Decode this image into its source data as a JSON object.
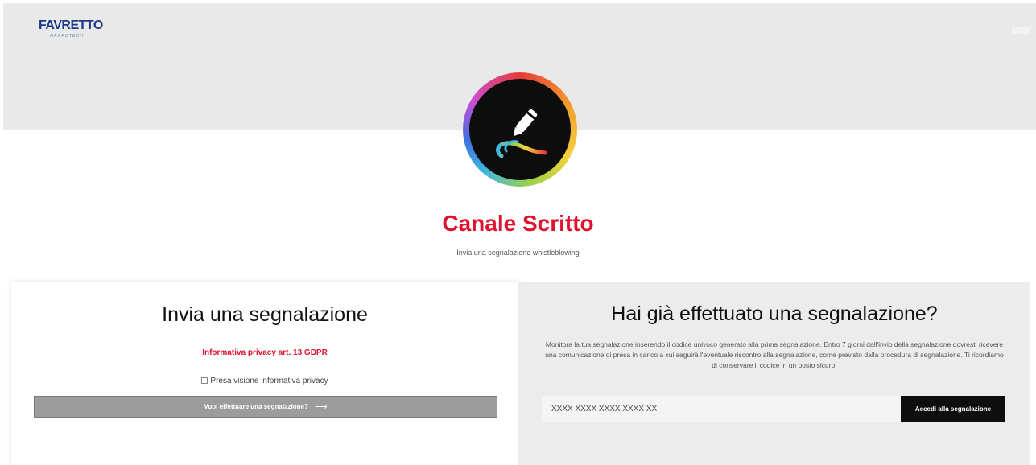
{
  "header": {
    "logo_main": "FAVRETTO",
    "logo_sub": "GRAFOTECH"
  },
  "hero": {
    "icon": "pen-stroke-icon",
    "title": "Canale Scritto",
    "subtitle": "Invia una segnalazione whistleblowing"
  },
  "send_panel": {
    "heading": "Invia una segnalazione",
    "privacy_link": "Informativa privacy art. 13 GDPR",
    "checkbox_label": "Presa visione informativa privacy",
    "cta_label": "Vuoi effettuare una segnalazione?",
    "cta_arrow": "⟶"
  },
  "track_panel": {
    "heading": "Hai già effettuato una segnalazione?",
    "description": "Monitora la tua segnalazione inserendo il codice univoco generato alla prima segnalazione. Entro 7 giorni dall'invio della segnalazione dovresti ricevere una comunicazione di presa in carico a cui seguirà l'eventuale riscontro alla segnalazione, come previsto dalla procedura di segnalazione. Ti ricordiamo di conservare il codice in un posto sicuro.",
    "code_placeholder": "XXXX XXXX XXXX XXXX XX",
    "access_label": "Accedi alla segnalazione"
  },
  "colors": {
    "accent": "#e0132e",
    "brand": "#1d3a8a",
    "band": "#e9e9e9",
    "button_dark": "#0e0e0e",
    "button_gray": "#9c9c9c"
  }
}
